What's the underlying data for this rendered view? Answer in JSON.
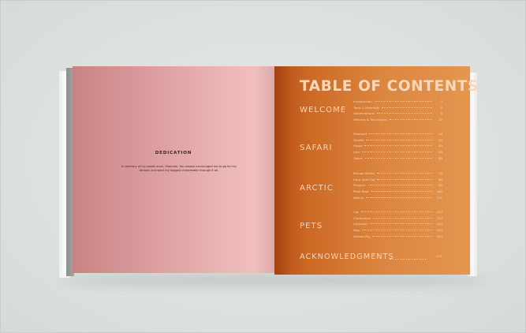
{
  "left_page": {
    "heading": "DEDICATION",
    "text": "In memory of my sweet mom, Shannon. You always encouraged me to go for my dreams and were my biggest cheerleader through it all."
  },
  "right_page": {
    "title": "TABLE OF CONTENTS",
    "sections": [
      {
        "name": "WELCOME",
        "entries": [
          {
            "name": "Introduction",
            "page": "3"
          },
          {
            "name": "Tools & Materials",
            "page": "4"
          },
          {
            "name": "Abbreviations",
            "page": "6"
          },
          {
            "name": "Stitches & Techniques",
            "page": "10"
          }
        ]
      },
      {
        "name": "SAFARI",
        "entries": [
          {
            "name": "Elephant",
            "page": "20"
          },
          {
            "name": "Giraffe",
            "page": "30"
          },
          {
            "name": "Hippo",
            "page": "40"
          },
          {
            "name": "Lion",
            "page": "50"
          },
          {
            "name": "Zebra",
            "page": "60"
          }
        ]
      },
      {
        "name": "ARCTIC",
        "entries": [
          {
            "name": "Beluga Whale",
            "page": "70"
          },
          {
            "name": "Harp Seal Pup",
            "page": "80"
          },
          {
            "name": "Penguin",
            "page": "90"
          },
          {
            "name": "Polar Bear",
            "page": "100"
          },
          {
            "name": "Walrus",
            "page": "112"
          }
        ]
      },
      {
        "name": "PETS",
        "entries": [
          {
            "name": "Cat",
            "page": "124"
          },
          {
            "name": "Chameleon",
            "page": "134"
          },
          {
            "name": "Cockatiel",
            "page": "144"
          },
          {
            "name": "Dog",
            "page": "154"
          },
          {
            "name": "Guinea Pig",
            "page": "164"
          }
        ]
      }
    ],
    "acknowledgments": {
      "name": "ACKNOWLEDGMENTS",
      "page": "174"
    }
  },
  "colors": {
    "background": "#dde2de",
    "left_page_pink": "#e9b2b1",
    "right_page_orange": "#d97f3a",
    "toc_text": "#f6d8bf"
  }
}
